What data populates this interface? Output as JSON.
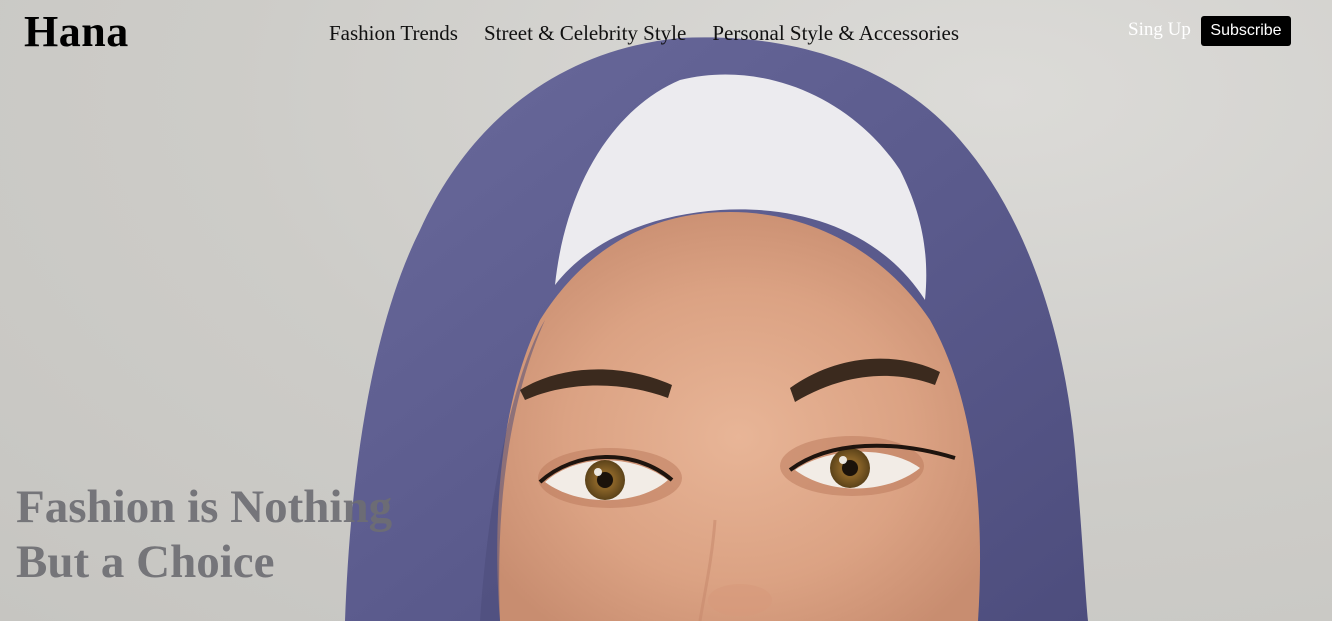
{
  "brand": {
    "logo": "Hana"
  },
  "nav": {
    "items": [
      {
        "label": "Fashion Trends"
      },
      {
        "label": "Street & Celebrity Style"
      },
      {
        "label": "Personal Style & Accessories"
      }
    ]
  },
  "header_actions": {
    "signup_label": "Sing Up",
    "subscribe_label": "Subscribe"
  },
  "hero": {
    "headline_line1": "Fashion is Nothing",
    "headline_line2": "But a Choice",
    "image_subject": "woman-in-purple-hijab-portrait"
  },
  "colors": {
    "background": "#cfcecb",
    "hijab": "#5d5d8f",
    "headline": "#6e6e73",
    "button": "#000000"
  }
}
